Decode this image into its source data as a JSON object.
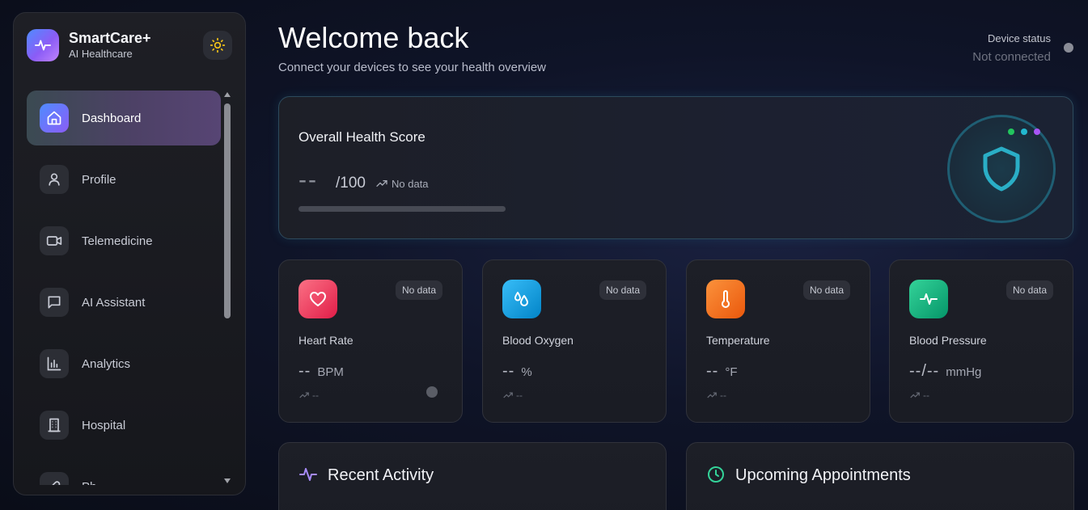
{
  "brand": {
    "name": "SmartCare+",
    "subtitle": "AI Healthcare"
  },
  "theme_toggle": {
    "icon": "sun-icon"
  },
  "nav": {
    "items": [
      {
        "label": "Dashboard",
        "icon": "home-icon",
        "active": true
      },
      {
        "label": "Profile",
        "icon": "user-icon"
      },
      {
        "label": "Telemedicine",
        "icon": "video-icon"
      },
      {
        "label": "AI Assistant",
        "icon": "chat-icon"
      },
      {
        "label": "Analytics",
        "icon": "bar-chart-icon"
      },
      {
        "label": "Hospital",
        "icon": "building-icon"
      },
      {
        "label": "Ph",
        "icon": "pill-icon"
      }
    ]
  },
  "header": {
    "title": "Welcome back",
    "subtitle": "Connect your devices to see your health overview",
    "device_status_label": "Device status",
    "device_status_value": "Not connected"
  },
  "health_score": {
    "title": "Overall Health Score",
    "value": "--",
    "max": "/100",
    "trend": "No data",
    "progress": 0,
    "icon": "shield-icon"
  },
  "metrics": [
    {
      "label": "Heart Rate",
      "value": "--",
      "unit": "BPM",
      "badge": "No data",
      "trend": "--",
      "icon": "heart-icon",
      "color": "#f43f6e"
    },
    {
      "label": "Blood Oxygen",
      "value": "--",
      "unit": "%",
      "badge": "No data",
      "trend": "--",
      "icon": "droplets-icon",
      "color": "#0ea5e9"
    },
    {
      "label": "Temperature",
      "value": "--",
      "unit": "°F",
      "badge": "No data",
      "trend": "--",
      "icon": "thermometer-icon",
      "color": "#f97316"
    },
    {
      "label": "Blood Pressure",
      "value": "--/--",
      "unit": "mmHg",
      "badge": "No data",
      "trend": "--",
      "icon": "activity-icon",
      "color": "#10b981"
    }
  ],
  "panels": {
    "recent_activity": {
      "title": "Recent Activity",
      "icon": "activity-icon",
      "color": "#a78bfa"
    },
    "appointments": {
      "title": "Upcoming Appointments",
      "icon": "clock-icon",
      "color": "#34d399"
    }
  },
  "colors": {
    "accent": "#8b5cf6",
    "cyan": "#55c2d8",
    "status_disconnected": "#8a8d97"
  }
}
